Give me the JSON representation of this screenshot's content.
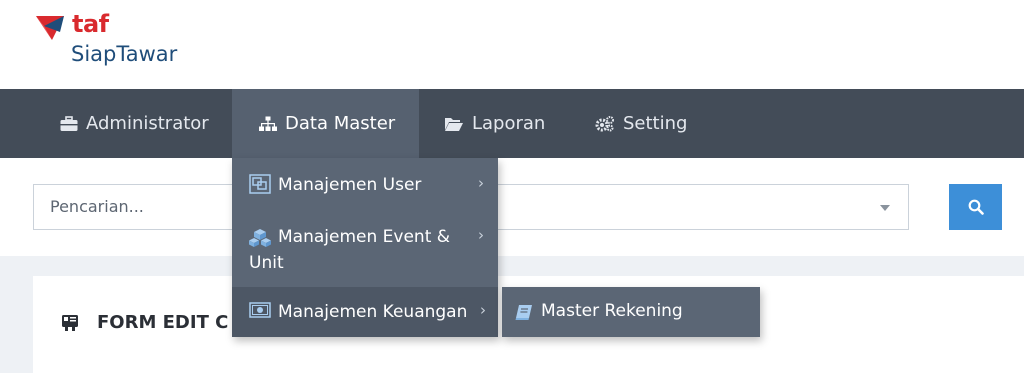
{
  "logo": {
    "brand": "taf",
    "name": "SiapTawar"
  },
  "nav": {
    "items": [
      {
        "label": "Administrator",
        "icon": "briefcase-icon"
      },
      {
        "label": "Data Master",
        "icon": "sitemap-icon",
        "active": true
      },
      {
        "label": "Laporan",
        "icon": "folder-open-icon"
      },
      {
        "label": "Setting",
        "icon": "gears-icon"
      }
    ]
  },
  "dropdown": {
    "items": [
      {
        "label": "Manajemen User",
        "icon": "users-frame-icon"
      },
      {
        "label": "Manajemen Event & Unit",
        "label_line1": "Manajemen Event &",
        "label_line2": "Unit",
        "icon": "cubes-icon"
      },
      {
        "label": "Manajemen Keuangan",
        "icon": "money-icon"
      }
    ],
    "chevron": "›"
  },
  "submenu": {
    "items": [
      {
        "label": "Master Rekening",
        "icon": "book-icon"
      }
    ]
  },
  "search": {
    "placeholder": "Pencarian..."
  },
  "card": {
    "title": "FORM EDIT C"
  },
  "colors": {
    "navbar": "#434c58",
    "dropdown": "#5b6675",
    "accent": "#3d8fd8",
    "brand_red": "#d92a2e",
    "brand_blue": "#1f4d7a"
  }
}
